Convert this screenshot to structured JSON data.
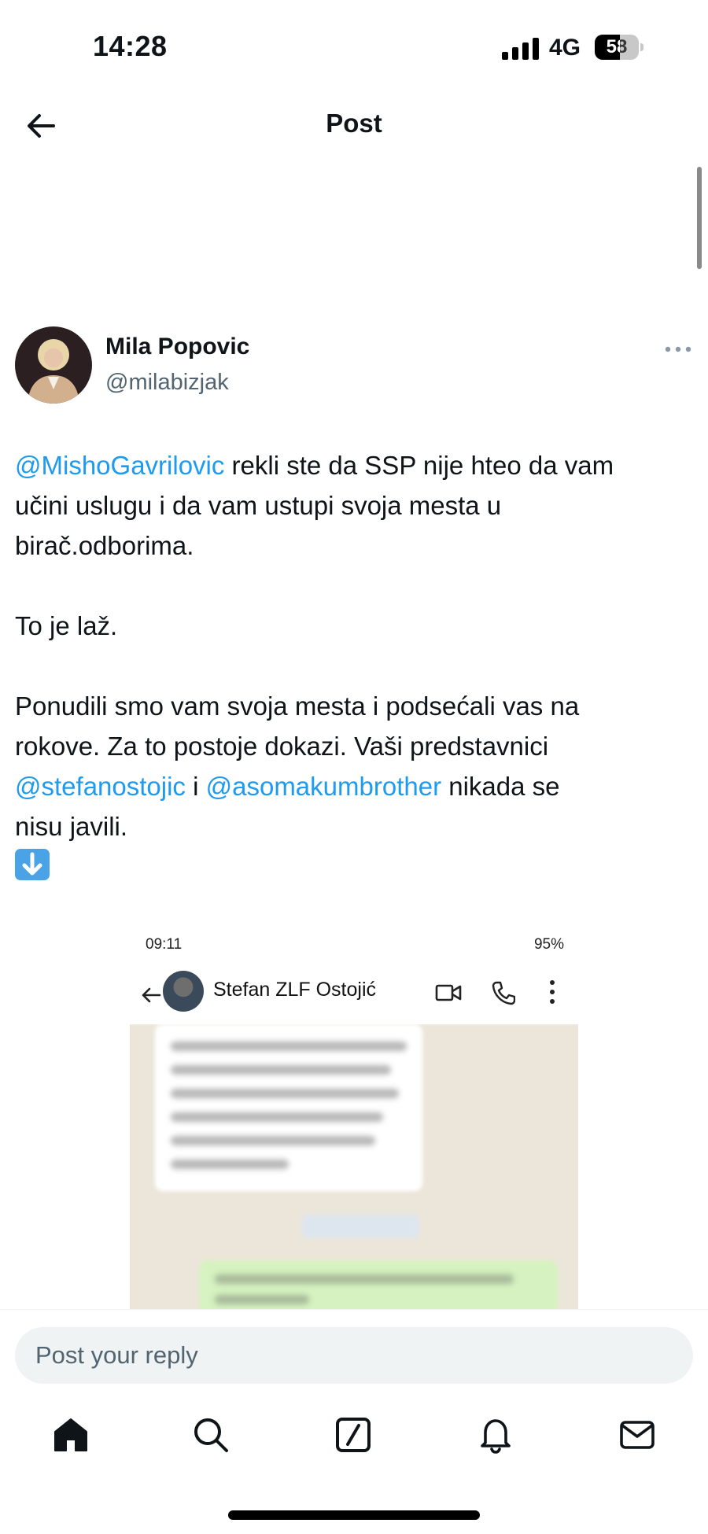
{
  "status_bar": {
    "time": "14:28",
    "network": "4G",
    "battery": "58",
    "battery_level": 0.58
  },
  "header": {
    "title": "Post"
  },
  "post": {
    "author_name": "Mila Popovic",
    "author_handle": "@milabizjak",
    "line1_mention": "@MishoGavrilovic",
    "line1_rest": " rekli ste da SSP nije hteo da vam",
    "line2": "učini uslugu i da vam ustupi svoja mesta u",
    "line3": "birač.odborima.",
    "line4": "To je laž.",
    "line5": "Ponudili smo vam svoja mesta i podsećali vas na",
    "line6": "rokove. Za to postoje dokazi. Vaši predstavnici",
    "line7_mention1": "@stefanostojic",
    "line7_mid": " i ",
    "line7_mention2": "@asomakumbrother",
    "line7_rest": " nikada se",
    "line8": "nisu javili.",
    "emoji_icon": "down-arrow-emoji-icon"
  },
  "media": {
    "time": "09:11",
    "status": "95%",
    "contact_name": "Stefan ZLF Ostojić",
    "icons": [
      "back-arrow-icon",
      "video-call-icon",
      "phone-icon",
      "more-vertical-icon"
    ]
  },
  "reply": {
    "placeholder": "Post your reply"
  },
  "tabs": [
    "home-icon",
    "search-icon",
    "compose-icon",
    "notifications-icon",
    "messages-icon"
  ],
  "colors": {
    "accent": "#1d9bf0",
    "text": "#0f1419",
    "secondary": "#536471",
    "reply_bg": "#eff3f4"
  }
}
